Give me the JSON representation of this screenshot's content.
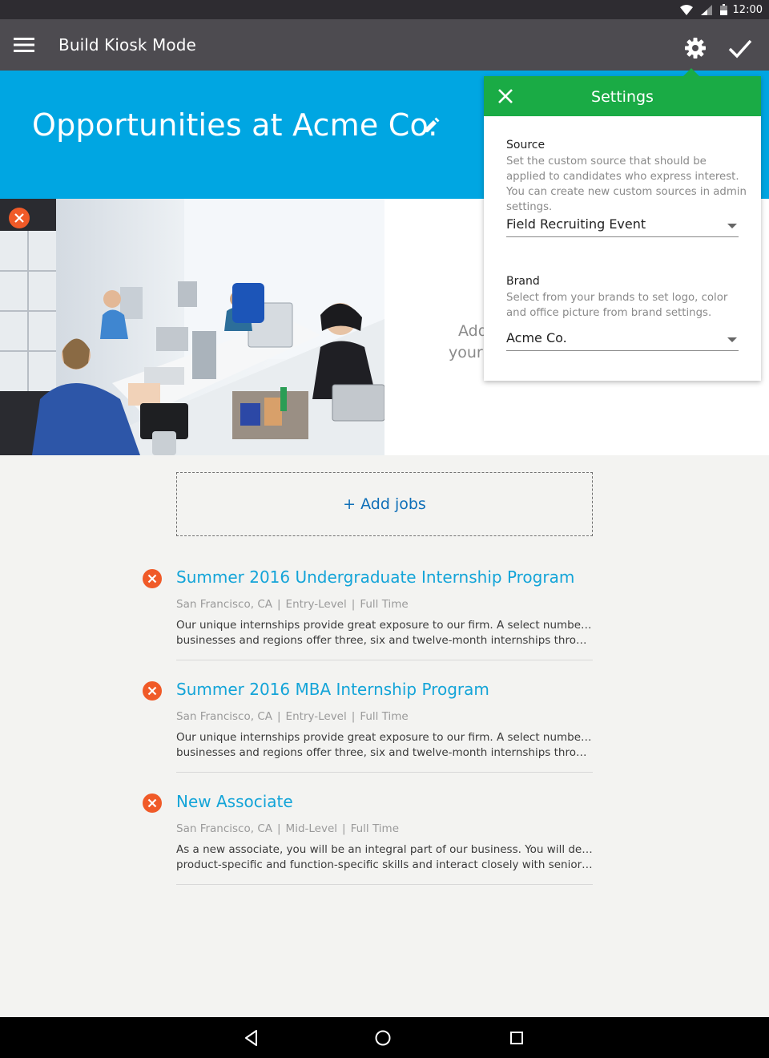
{
  "status_bar": {
    "time": "12:00"
  },
  "app_bar": {
    "title": "Build Kiosk Mode"
  },
  "hero": {
    "heading": "Opportunities at Acme Co."
  },
  "about": {
    "line1": "Add",
    "line2": "your"
  },
  "add_jobs": {
    "label": "+ Add jobs"
  },
  "jobs": [
    {
      "title": "Summer 2016 Undergraduate Internship Program",
      "location": "San Francisco, CA",
      "level": "Entry-Level",
      "type": "Full Time",
      "desc_line1": "Our unique internships provide great exposure to our firm. A select number of",
      "desc_line2": "businesses and regions offer three, six and twelve-month internships throughout..."
    },
    {
      "title": "Summer 2016 MBA Internship Program",
      "location": "San Francisco, CA",
      "level": "Entry-Level",
      "type": "Full Time",
      "desc_line1": "Our unique internships provide great exposure to our firm. A select number of",
      "desc_line2": "businesses and regions offer three, six and twelve-month internships throughout..."
    },
    {
      "title": "New Associate",
      "location": "San Francisco, CA",
      "level": "Mid-Level",
      "type": "Full Time",
      "desc_line1": "As a new associate, you will be an integral part of our business. You will develop",
      "desc_line2": "product-specific and function-specific skills and interact closely with senior pro..."
    }
  ],
  "meta_separator": "|",
  "settings": {
    "title": "Settings",
    "source": {
      "label": "Source",
      "help": "Set the custom source that should be applied to candidates who express interest. You can create new custom sources in admin settings.",
      "value": "Field Recruiting Event"
    },
    "brand": {
      "label": "Brand",
      "help": "Select from your brands to set logo, color and office picture from brand settings.",
      "value": "Acme Co."
    }
  },
  "colors": {
    "status_bar": "#2e2c31",
    "app_bar": "#4d4b50",
    "hero": "#00a6e2",
    "settings_header": "#1aab45",
    "job_title": "#13a4d8",
    "remove_badge": "#f05a28",
    "add_jobs_text": "#0f6fb8"
  },
  "icons": {
    "menu": "hamburger-menu-icon",
    "settings": "gear-icon",
    "confirm": "check-icon",
    "edit": "pencil-icon",
    "close": "close-icon",
    "remove": "remove-x-icon",
    "nav_back": "triangle-back-icon",
    "nav_home": "circle-home-icon",
    "nav_recents": "square-recents-icon"
  }
}
